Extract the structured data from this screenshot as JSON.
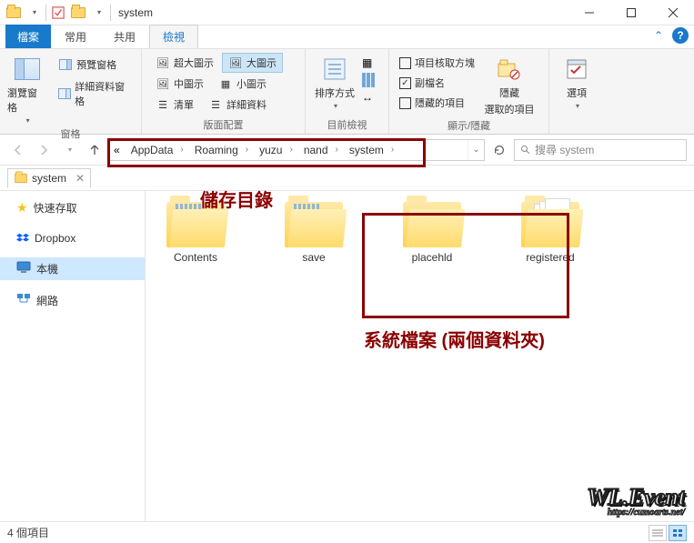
{
  "window": {
    "title": "system"
  },
  "tabs": {
    "file": "檔案",
    "home": "常用",
    "share": "共用",
    "view": "檢視"
  },
  "ribbon": {
    "group_panes": {
      "nav_pane": "瀏覽窗格",
      "preview_pane": "預覽窗格",
      "details_pane": "詳細資料窗格",
      "label": "窗格"
    },
    "group_layout": {
      "extra_large": "超大圖示",
      "large": "大圖示",
      "medium": "中圖示",
      "small": "小圖示",
      "list": "清單",
      "details": "詳細資料",
      "label": "版面配置"
    },
    "group_view": {
      "sort_by": "排序方式",
      "label": "目前檢視"
    },
    "group_showhide": {
      "item_checkboxes": "項目核取方塊",
      "file_ext": "副檔名",
      "hidden_items": "隱藏的項目",
      "hide_selected_top": "隱藏",
      "hide_selected_bottom": "選取的項目",
      "label": "顯示/隱藏"
    },
    "group_options": {
      "options": "選項"
    }
  },
  "breadcrumb": {
    "parts": [
      "AppData",
      "Roaming",
      "yuzu",
      "nand",
      "system"
    ]
  },
  "search": {
    "placeholder": "搜尋 system"
  },
  "tabstrip": {
    "name": "system"
  },
  "sidebar": {
    "quick_access": "快速存取",
    "dropbox": "Dropbox",
    "this_pc": "本機",
    "network": "網路"
  },
  "folders": {
    "contents": "Contents",
    "save": "save",
    "placehld": "placehld",
    "registered": "registered"
  },
  "annotations": {
    "path_label": "儲存目錄",
    "sys_label": "系統檔案 (兩個資料夾)"
  },
  "status": {
    "count": "4 個項目"
  },
  "watermark": {
    "big": "WL.Event",
    "small": "https://cumoarts.net/"
  }
}
